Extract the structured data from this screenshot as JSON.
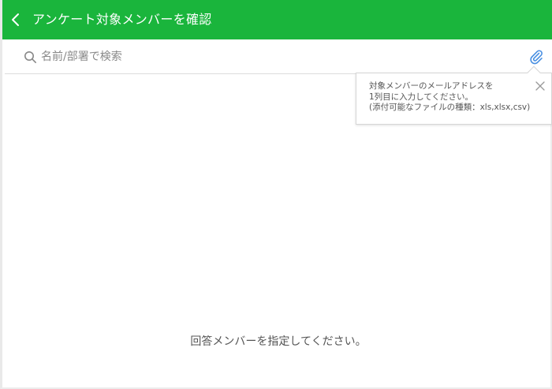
{
  "header": {
    "title": "アンケート対象メンバーを確認",
    "back_icon": "chevron-left-icon",
    "background_color": "#1ab53c"
  },
  "search": {
    "placeholder": "名前/部署で検索",
    "value": "",
    "icon": "search-icon"
  },
  "attach": {
    "icon": "paperclip-icon",
    "color": "#4a90e2"
  },
  "tooltip": {
    "line1": "対象メンバーのメールアドレスを",
    "line2": "1列目に入力してください。",
    "line3": "(添付可能なファイルの種類：xls,xlsx,csv)",
    "close_icon": "close-icon"
  },
  "main": {
    "empty_message": "回答メンバーを指定してください。"
  }
}
